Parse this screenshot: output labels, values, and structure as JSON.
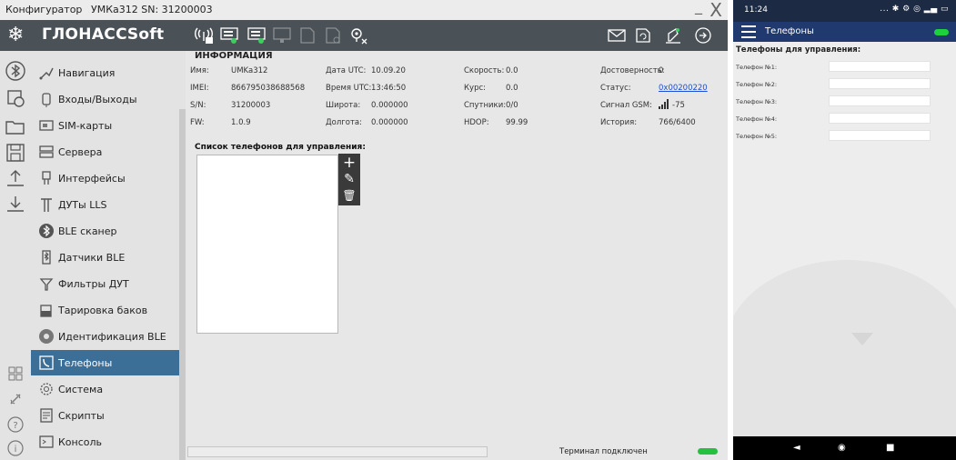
{
  "window": {
    "title": "Конфигуратор",
    "subtitle": "УМКа312 SN: 31200003",
    "close_glyph": "X",
    "min_glyph": "_"
  },
  "logo": {
    "text": "ГЛОНАССSoft"
  },
  "toolbar": {
    "icons": [
      "antenna-icon",
      "device-read-icon",
      "device-write-icon",
      "device-disabled-icon",
      "file-disabled-icon",
      "file-settings-icon",
      "location-off-icon",
      "envelope-icon",
      "refresh-icon",
      "satellite-icon",
      "firmware-icon"
    ]
  },
  "sidebar": {
    "items": [
      {
        "label": "Навигация",
        "icon": "navigation-icon"
      },
      {
        "label": "Входы/Выходы",
        "icon": "io-icon"
      },
      {
        "label": "SIM-карты",
        "icon": "sim-icon"
      },
      {
        "label": "Сервера",
        "icon": "server-icon"
      },
      {
        "label": "Интерфейсы",
        "icon": "interface-icon"
      },
      {
        "label": "ДУТы LLS",
        "icon": "fuel-sensor-icon"
      },
      {
        "label": "BLE сканер",
        "icon": "bluetooth-icon"
      },
      {
        "label": "Датчики BLE",
        "icon": "ble-sensor-icon"
      },
      {
        "label": "Фильтры ДУТ",
        "icon": "filter-icon"
      },
      {
        "label": "Тарировка баков",
        "icon": "tank-icon"
      },
      {
        "label": "Идентификация BLE",
        "icon": "ble-id-icon"
      },
      {
        "label": "Телефоны",
        "icon": "phone-icon",
        "active": true
      },
      {
        "label": "Система",
        "icon": "system-icon"
      },
      {
        "label": "Скрипты",
        "icon": "script-icon"
      },
      {
        "label": "Консоль",
        "icon": "console-icon"
      }
    ]
  },
  "info": {
    "heading": "ИНФОРМАЦИЯ",
    "name_label": "Имя:",
    "name_value": "UMKa312",
    "imei_label": "IMEI:",
    "imei_value": "866795038688568",
    "sn_label": "S/N:",
    "sn_value": "31200003",
    "fw_label": "FW:",
    "fw_value": "1.0.9",
    "date_label": "Дата UTC:",
    "date_value": "10.09.20",
    "time_label": "Время UTC:",
    "time_value": "13:46:50",
    "lat_label": "Широта:",
    "lat_value": "0.000000",
    "lon_label": "Долгота:",
    "lon_value": "0.000000",
    "speed_label": "Скорость:",
    "speed_value": "0.0",
    "course_label": "Курс:",
    "course_value": "0.0",
    "sats_label": "Спутники:",
    "sats_value": "0/0",
    "hdop_label": "HDOP:",
    "hdop_value": "99.99",
    "valid_label": "Достоверность:",
    "valid_value": "0",
    "status_label": "Статус:",
    "status_value": "0x00200220",
    "gsm_label": "Сигнал GSM:",
    "gsm_value": "-75",
    "history_label": "История:",
    "history_value": "766/6400"
  },
  "phones": {
    "list_label": "Список телефонов для управления:",
    "add_glyph": "+",
    "edit_glyph": "✎",
    "delete_glyph": "🗑"
  },
  "status": {
    "text": "Терминал подключен"
  },
  "phone": {
    "time": "11:24",
    "status_icons": "... ✱ ⚙ ◎ ▂▄ ▭",
    "title": "Телефоны",
    "form_header": "Телефоны для управления:",
    "fields": [
      {
        "label": "Телефон №1:",
        "value": ""
      },
      {
        "label": "Телефон №2:",
        "value": ""
      },
      {
        "label": "Телефон №3:",
        "value": ""
      },
      {
        "label": "Телефон №4:",
        "value": ""
      },
      {
        "label": "Телефон №5:",
        "value": ""
      }
    ],
    "nav": {
      "back": "◄",
      "home": "◉",
      "recent": "■"
    }
  },
  "colors": {
    "accent": "#3c6f97",
    "toolbar": "#4a5157",
    "connected": "#25c03d",
    "phone_bar": "#203a70"
  }
}
